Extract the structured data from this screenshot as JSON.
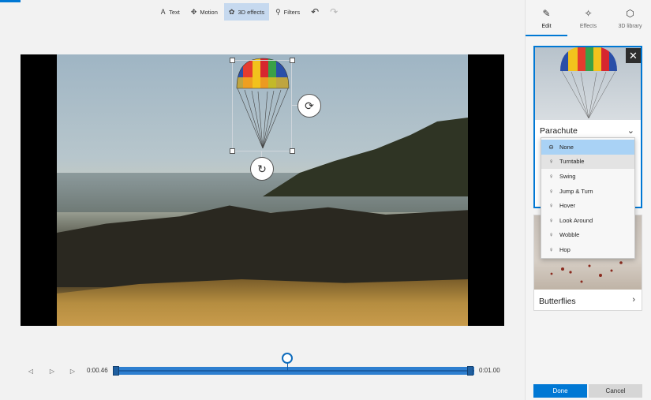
{
  "toolbar": {
    "text_label": "Text",
    "motion_label": "Motion",
    "effects3d_label": "3D effects",
    "filters_label": "Filters",
    "undo_icon": "undo-icon",
    "redo_icon": "redo-icon"
  },
  "timeline": {
    "current_time": "0:00.46",
    "end_time": "0:01.00",
    "playhead_progress": 0.48
  },
  "panel": {
    "tabs": [
      {
        "label": "Edit",
        "icon": "pencil-icon"
      },
      {
        "label": "Effects",
        "icon": "sparkle-icon"
      },
      {
        "label": "3D library",
        "icon": "cube-icon"
      }
    ],
    "selected_card_label": "Parachute",
    "second_card_label": "Butterflies",
    "close_glyph": "✕",
    "dropdown_items": [
      {
        "label": "None",
        "icon": "none-icon"
      },
      {
        "label": "Turntable",
        "icon": "turntable-icon"
      },
      {
        "label": "Swing",
        "icon": "swing-icon"
      },
      {
        "label": "Jump & Turn",
        "icon": "jump-turn-icon"
      },
      {
        "label": "Hover",
        "icon": "hover-icon"
      },
      {
        "label": "Look Around",
        "icon": "look-around-icon"
      },
      {
        "label": "Wobble",
        "icon": "wobble-icon"
      },
      {
        "label": "Hop",
        "icon": "hop-icon"
      }
    ],
    "done_label": "Done",
    "cancel_label": "Cancel"
  },
  "colors": {
    "accent": "#0078d4",
    "selected_item": "#a9d2f5"
  }
}
